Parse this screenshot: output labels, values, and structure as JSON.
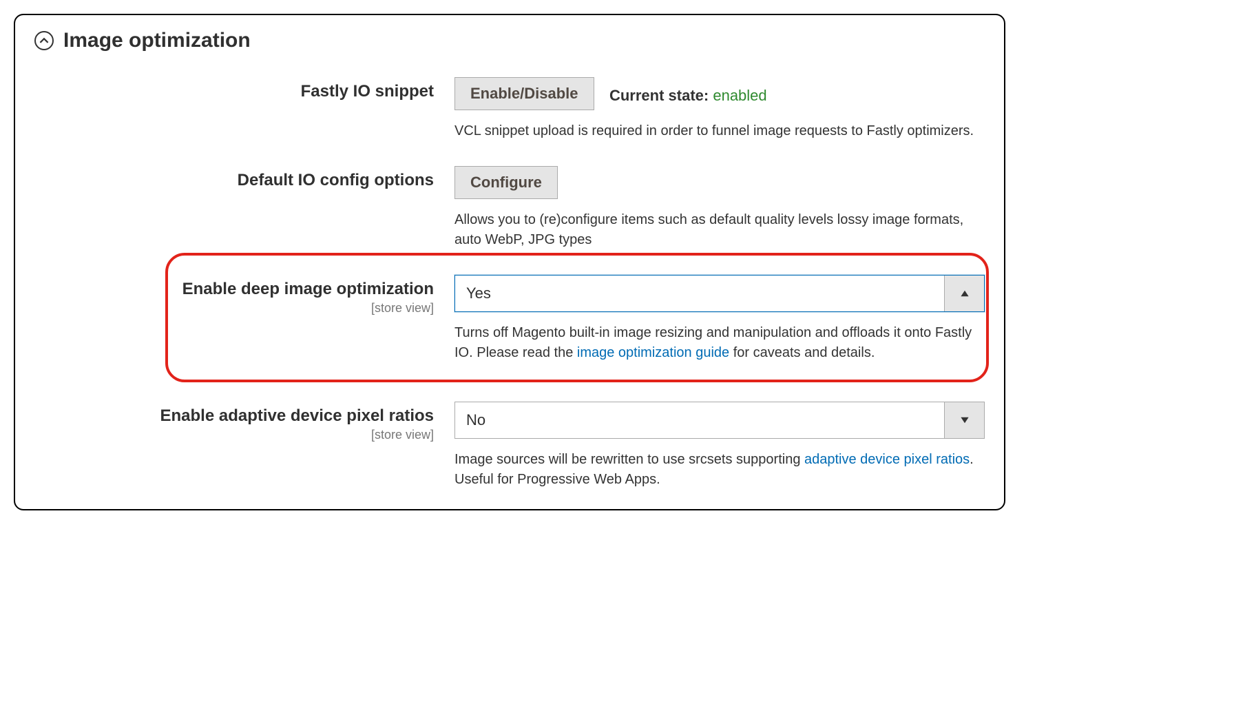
{
  "panel": {
    "title": "Image optimization"
  },
  "fields": {
    "snippet": {
      "label": "Fastly IO snippet",
      "button": "Enable/Disable",
      "state_label": "Current state:",
      "state_value": "enabled",
      "help": "VCL snippet upload is required in order to funnel image requests to Fastly optimizers."
    },
    "config": {
      "label": "Default IO config options",
      "button": "Configure",
      "help": "Allows you to (re)configure items such as default quality levels lossy image formats, auto WebP, JPG types"
    },
    "deep": {
      "label": "Enable deep image optimization",
      "scope": "[store view]",
      "value": "Yes",
      "help_pre": "Turns off Magento built-in image resizing and manipulation and offloads it onto Fastly IO. Please read the ",
      "help_link": "image optimization guide",
      "help_post": " for caveats and details."
    },
    "adaptive": {
      "label": "Enable adaptive device pixel ratios",
      "scope": "[store view]",
      "value": "No",
      "help_pre": "Image sources will be rewritten to use srcsets supporting ",
      "help_link": "adaptive device pixel ratios",
      "help_post": ". Useful for Progressive Web Apps."
    }
  }
}
